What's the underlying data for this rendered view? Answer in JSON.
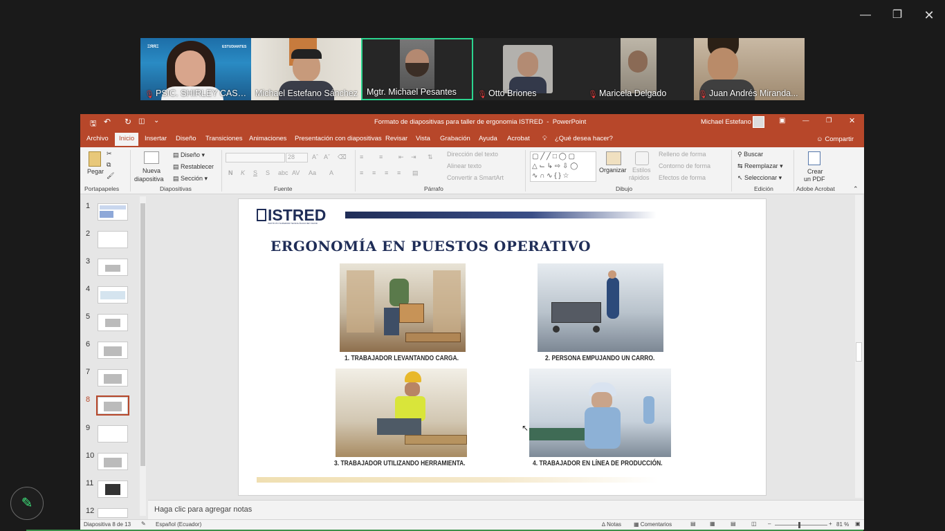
{
  "call": {
    "participants": [
      {
        "name": "PSIC. SHIRLEY CASTR...",
        "muted": true,
        "active_speaker": false
      },
      {
        "name": "Michael Estefano Sánchez",
        "muted": false,
        "active_speaker": false
      },
      {
        "name": "Mgtr. Michael Pesantes",
        "muted": false,
        "active_speaker": true
      },
      {
        "name": "Otto Briones",
        "muted": true,
        "active_speaker": false
      },
      {
        "name": "Maricela Delgado",
        "muted": true,
        "active_speaker": false
      },
      {
        "name": "Juan Andrés Miranda...",
        "muted": true,
        "active_speaker": false
      }
    ],
    "tile_label": "ESTUDIANTES"
  },
  "ppt": {
    "title": "Formato de diapositivas para taller de ergonomia ISTRED",
    "app": "PowerPoint",
    "user": "Michael Estefano",
    "tabs": [
      "Archivo",
      "Inicio",
      "Insertar",
      "Diseño",
      "Transiciones",
      "Animaciones",
      "Presentación con diapositivas",
      "Revisar",
      "Vista",
      "Grabación",
      "Ayuda",
      "Acrobat"
    ],
    "active_tab": "Inicio",
    "tell_me": "¿Qué desea hacer?",
    "share": "Compartir",
    "ribbon": {
      "clipboard": {
        "paste": "Pegar",
        "label": "Portapapeles"
      },
      "slides": {
        "new_slide_1": "Nueva",
        "new_slide_2": "diapositiva",
        "layout": "Diseño",
        "reset": "Restablecer",
        "section": "Sección",
        "label": "Diapositivas"
      },
      "font": {
        "label": "Fuente",
        "size": "28"
      },
      "paragraph": {
        "text_direction": "Dirección del texto",
        "align_text": "Alinear texto",
        "smartart": "Convertir a SmartArt",
        "label": "Párrafo"
      },
      "drawing": {
        "arrange": "Organizar",
        "quick_styles_1": "Estilos",
        "quick_styles_2": "rápidos",
        "fill": "Relleno de forma",
        "outline": "Contorno de forma",
        "effects": "Efectos de forma",
        "label": "Dibujo"
      },
      "editing": {
        "find": "Buscar",
        "replace": "Reemplazar",
        "select": "Seleccionar",
        "label": "Edición"
      },
      "acrobat": {
        "create_1": "Crear",
        "create_2": "un PDF",
        "label": "Adobe Acrobat"
      }
    },
    "thumbnails": [
      "1",
      "2",
      "3",
      "4",
      "5",
      "6",
      "7",
      "8",
      "9",
      "10",
      "11",
      "12"
    ],
    "current_slide": 8,
    "slide": {
      "logo": "ISTRED",
      "logo_sub": "INSTITUTO SUPERIOR TECNOLÓGICO REY DAVID",
      "title": "ERGONOMÍA EN PUESTOS OPERATIVO",
      "captions": [
        "1. TRABAJADOR LEVANTANDO CARGA.",
        "2. PERSONA EMPUJANDO UN CARRO.",
        "3. TRABAJADOR UTILIZANDO HERRAMIENTA.",
        "4. TRABAJADOR EN LÍNEA DE PRODUCCIÓN."
      ]
    },
    "notes_placeholder": "Haga clic para agregar notas",
    "status": {
      "slide_info": "Diapositiva 8 de 13",
      "language": "Español (Ecuador)",
      "notes": "Notas",
      "comments": "Comentarios",
      "zoom": "81 %"
    }
  }
}
